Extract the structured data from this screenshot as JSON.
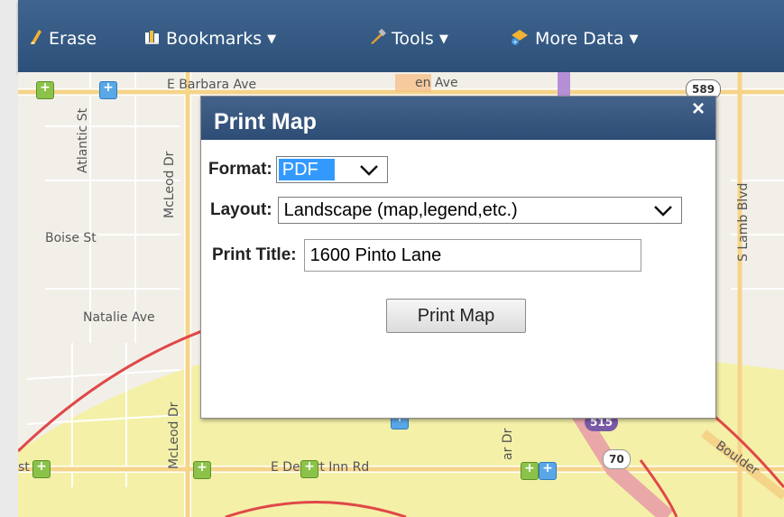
{
  "toolbar": {
    "items": [
      {
        "label": "Erase",
        "icon": "eraser-icon"
      },
      {
        "label": "Bookmarks",
        "icon": "bookmarks-icon"
      },
      {
        "label": "Tools",
        "icon": "tools-icon"
      },
      {
        "label": "More Data",
        "icon": "more-data-icon"
      }
    ]
  },
  "map": {
    "labels": {
      "barbara_ave": "E Barbara Ave",
      "glen_ave": "en Ave",
      "atlantic_st": "Atlantic St",
      "mcleod_dr_north": "McLeod Dr",
      "mcleod_dr_south": "McLeod Dr",
      "boise_st": "Boise St",
      "natalie_ave": "Natalie Ave",
      "lamb_blvd": "S Lamb Blvd",
      "desert_inn_rd": "E Desert Inn Rd",
      "boulder": "Boulder",
      "st_partial": "st",
      "dr_partial": "ar Dr"
    },
    "shields": {
      "r589": "589",
      "r515": "515",
      "r70": "70"
    }
  },
  "dialog": {
    "title": "Print Map",
    "close": "×",
    "format_label": "Format:",
    "format_value": "PDF",
    "layout_label": "Layout:",
    "layout_value": "Landscape (map,legend,etc.)",
    "print_title_label": "Print Title:",
    "print_title_value": "1600 Pinto Lane",
    "print_button": "Print Map"
  },
  "colors": {
    "toolbar": "#34587f",
    "dialog_header": "#3a5a82",
    "selected_format": "#3399ff",
    "buffer_circle": "#e04848",
    "zone_fill": "#f4f0a8"
  }
}
